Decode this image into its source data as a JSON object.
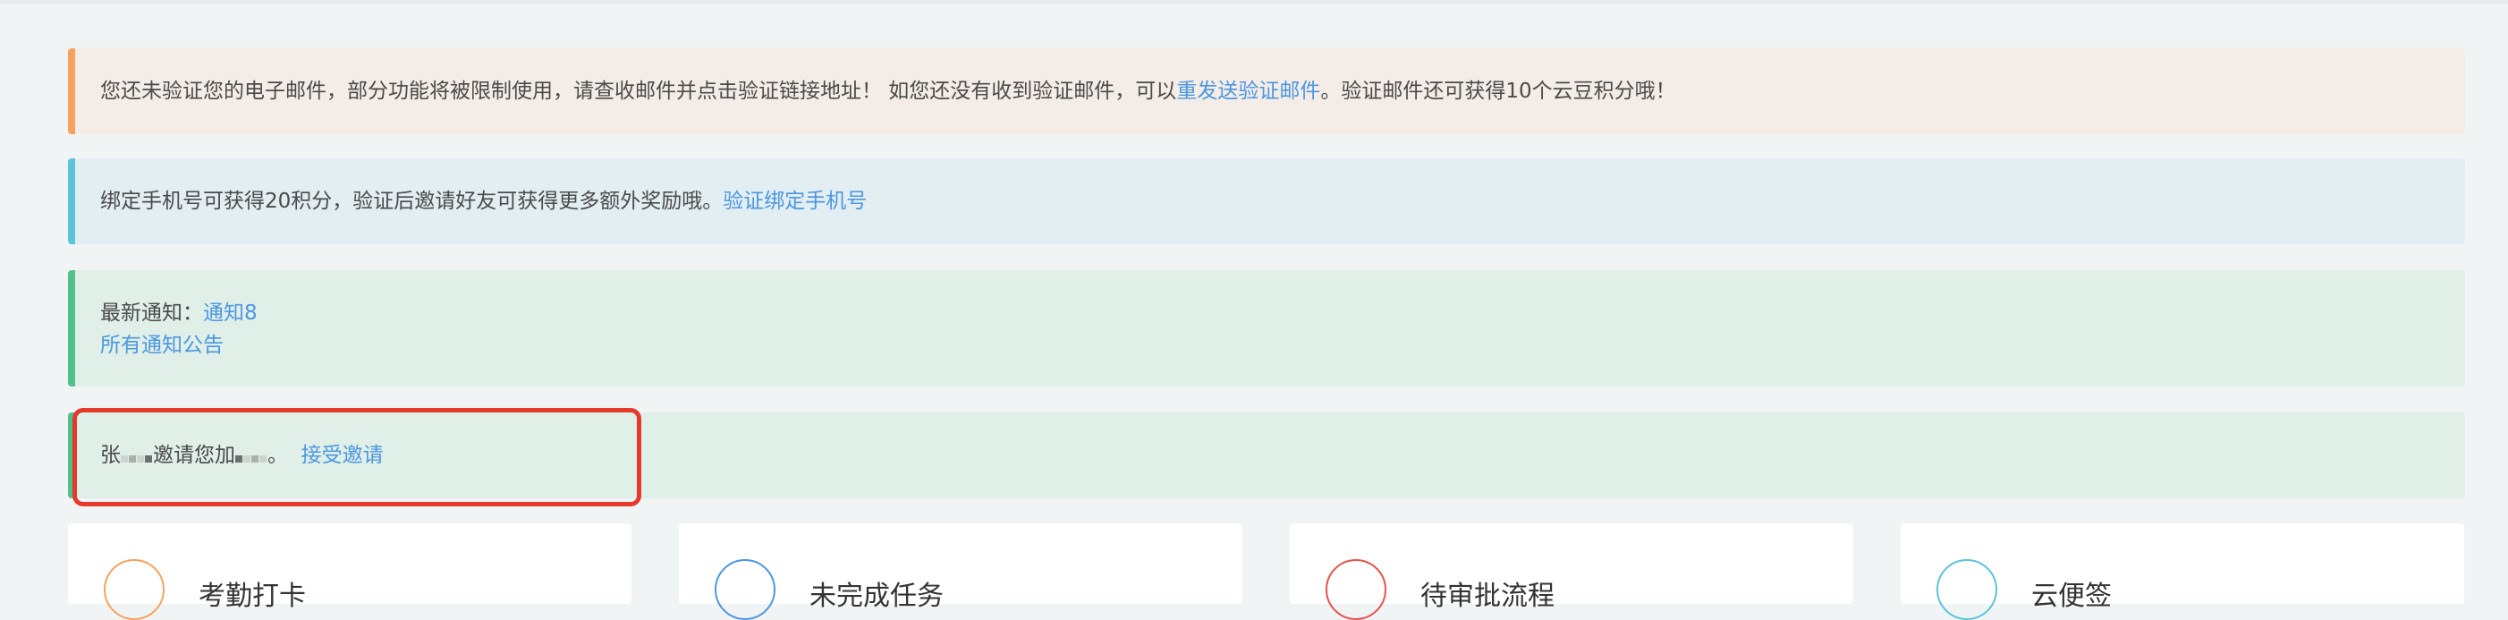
{
  "email_alert": {
    "text_before": "您还未验证您的电子邮件，部分功能将被限制使用，请查收邮件并点击验证链接地址！ 如您还没有收到验证邮件，可以",
    "link": "重发送验证邮件",
    "text_after": "。验证邮件还可获得10个云豆积分哦！"
  },
  "phone_alert": {
    "text": "绑定手机号可获得20积分，验证后邀请好友可获得更多额外奖励哦。",
    "link": "验证绑定手机号"
  },
  "notice_alert": {
    "label": "最新通知：",
    "latest_link": "通知8",
    "all_link": "所有通知公告"
  },
  "invite_alert": {
    "inviter_initial": "张",
    "text": "邀请您加",
    "punct": "。",
    "link": "接受邀请"
  },
  "cards": [
    {
      "title": "考勤打卡",
      "icon": "clock-icon",
      "color": "#f6a25e"
    },
    {
      "title": "未完成任务",
      "icon": "task-icon",
      "color": "#4b97e0"
    },
    {
      "title": "待审批流程",
      "icon": "approval-icon",
      "color": "#e5534b"
    },
    {
      "title": "云便签",
      "icon": "note-icon",
      "color": "#5bc4d8"
    }
  ],
  "colors": {
    "warning": "#f6a25e",
    "info": "#5bc4d8",
    "success": "#51c08c",
    "link": "#4b97e0",
    "highlight": "#e53a2b"
  }
}
